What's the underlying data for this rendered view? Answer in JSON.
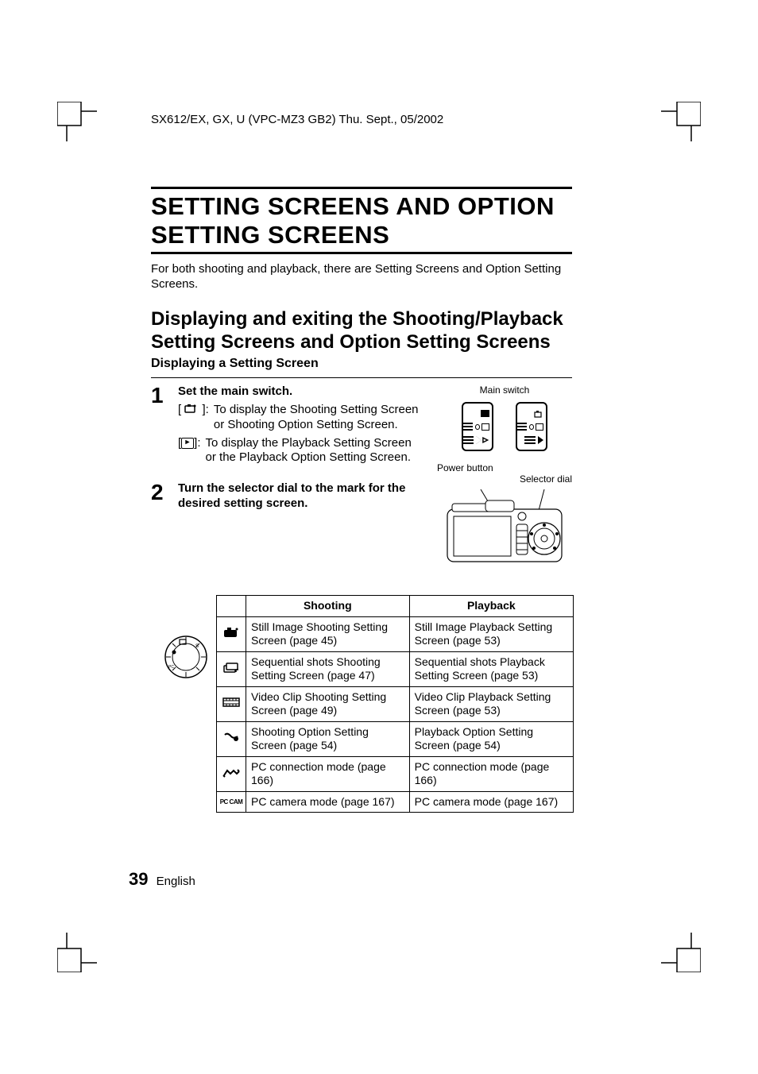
{
  "header": {
    "doc_id": "SX612/EX, GX, U (VPC-MZ3 GB2)    Thu. Sept., 05/2002"
  },
  "title": "SETTING SCREENS AND OPTION SETTING SCREENS",
  "intro": "For both shooting and playback, there are Setting Screens and Option Setting Screens.",
  "section": "Displaying and exiting the Shooting/Playback Setting Screens and Option Setting Screens",
  "subsection": "Displaying a Setting Screen",
  "steps": [
    {
      "num": "1",
      "title": "Set the main switch.",
      "subs": [
        {
          "text": "To display the Shooting Setting Screen or Shooting Option Setting Screen."
        },
        {
          "text": "To display the Playback Setting Screen or the Playback Option Setting Screen."
        }
      ]
    },
    {
      "num": "2",
      "title": "Turn the selector dial to the mark for the desired setting screen.",
      "subs": []
    }
  ],
  "labels": {
    "main_switch": "Main switch",
    "power_button": "Power button",
    "selector_dial": "Selector dial"
  },
  "table": {
    "headers": {
      "col1": "Shooting",
      "col2": "Playback"
    },
    "rows": [
      {
        "icon": "still",
        "shooting": "Still Image Shooting Setting Screen (page 45)",
        "playback": "Still Image Playback Setting Screen (page 53)"
      },
      {
        "icon": "sequential",
        "shooting": "Sequential shots Shooting Setting Screen (page 47)",
        "playback": "Sequential shots Playback Setting Screen (page 53)"
      },
      {
        "icon": "video",
        "shooting": "Video Clip Shooting Setting Screen (page 49)",
        "playback": "Video Clip Playback Setting Screen (page 53)"
      },
      {
        "icon": "option",
        "shooting": "Shooting Option Setting Screen (page 54)",
        "playback": "Playback Option Setting Screen (page 54)"
      },
      {
        "icon": "pc",
        "shooting": "PC connection mode (page 166)",
        "playback": "PC connection mode (page 166)"
      },
      {
        "icon": "pccam",
        "shooting": "PC camera mode (page 167)",
        "playback": "PC camera mode (page 167)"
      }
    ]
  },
  "footer": {
    "page_num": "39",
    "lang": "English"
  },
  "icons": {
    "pccam_text": "PC CAM"
  }
}
